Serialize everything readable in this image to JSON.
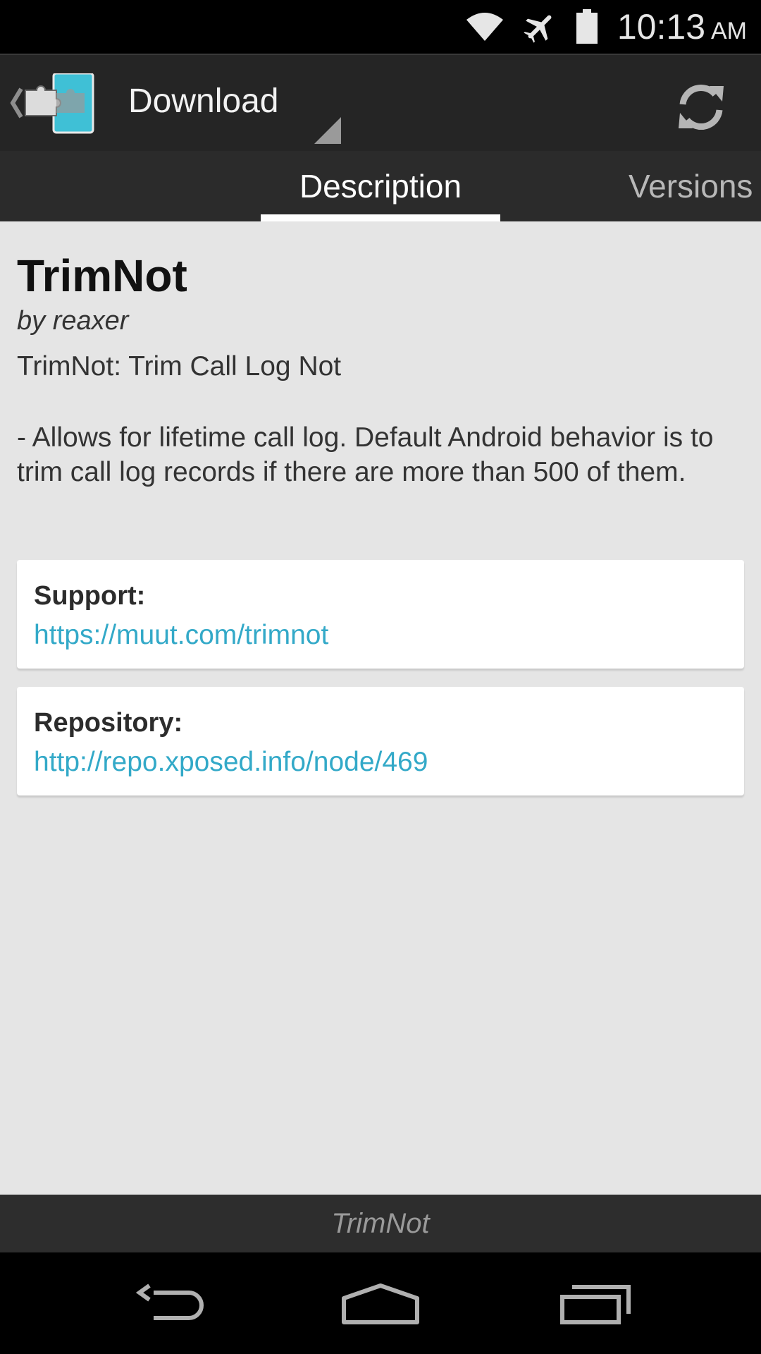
{
  "status_bar": {
    "time": "10:13",
    "ampm": "AM",
    "icons": [
      "wifi-icon",
      "airplane-mode-icon",
      "battery-icon"
    ]
  },
  "action_bar": {
    "nav_title": "Download",
    "icons": [
      "up-caret-icon",
      "xposed-app-icon",
      "spinner-triangle-icon",
      "refresh-icon"
    ]
  },
  "tabs": [
    {
      "label": "Description",
      "active": true
    },
    {
      "label": "Versions",
      "active": false
    }
  ],
  "module": {
    "title": "TrimNot",
    "author": "by reaxer",
    "summary": "TrimNot: Trim Call Log Not",
    "description": "- Allows for lifetime call log. Default Android behavior is to trim call log records if there are more than 500 of them.",
    "support": {
      "label": "Support:",
      "link": "https://muut.com/trimnot"
    },
    "repository": {
      "label": "Repository:",
      "link": "http://repo.xposed.info/node/469"
    }
  },
  "footer": {
    "label": "TrimNot"
  },
  "nav_bar": {
    "icons": [
      "back-icon",
      "home-icon",
      "recents-icon"
    ]
  },
  "colors": {
    "link": "#33a9c8",
    "background": "#e5e5e5",
    "action_bar": "#252525",
    "tab_bar": "#2b2b2b",
    "app_icon_accent": "#3fc0d6"
  }
}
